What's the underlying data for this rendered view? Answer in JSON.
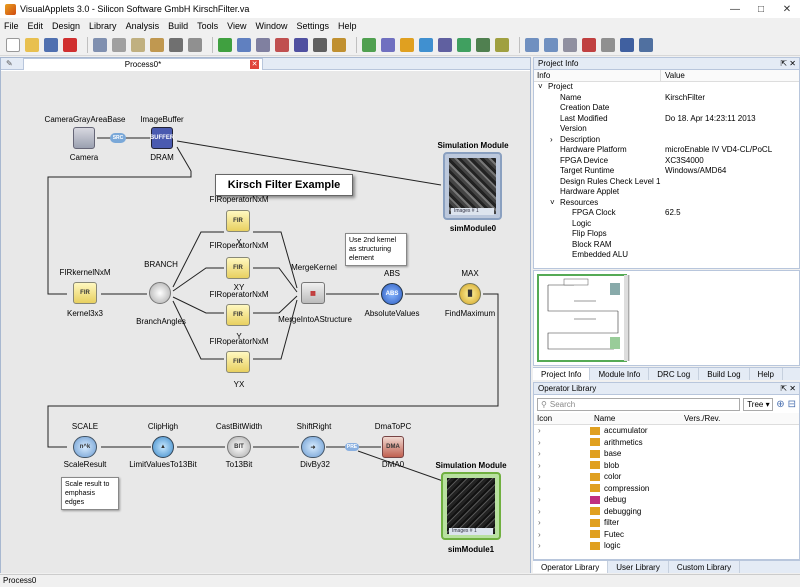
{
  "window": {
    "title": "VisualApplets 3.0 - Silicon Software GmbH   KirschFilter.va"
  },
  "menu": [
    "File",
    "Edit",
    "Design",
    "Library",
    "Analysis",
    "Build",
    "Tools",
    "View",
    "Window",
    "Settings",
    "Help"
  ],
  "editor": {
    "tab_label": "Process0*",
    "banner": "Kirsch Filter Example",
    "nodes": {
      "camera_top": "CameraGrayAreaBase",
      "camera_bottom": "Camera",
      "imagebuffer_top": "ImageBuffer",
      "imagebuffer_bottom": "DRAM",
      "fir_x_top": "FIRoperatorNxM",
      "fir_x_bottom": "X",
      "fir_xy_top": "FIRoperatorNxM",
      "fir_xy_bottom": "XY",
      "fir_y_top": "FIRoperatorNxM",
      "fir_y_bottom": "Y",
      "fir_yx_top": "FIRoperatorNxM",
      "fir_yx_bottom": "YX",
      "kernel_top": "FIRkernelNxM",
      "kernel_bottom": "Kernel3x3",
      "branch_top": "BRANCH",
      "branch_bottom": "BranchAngles",
      "merge_top": "MergeKernel",
      "merge_bottom": "MergeIntoAStructure",
      "abs_top": "ABS",
      "abs_bottom": "AbsoluteValues",
      "max_top": "MAX",
      "max_bottom": "FindMaximum",
      "scale_top": "SCALE",
      "scale_bottom": "ScaleResult",
      "clip_top": "ClipHigh",
      "clip_bottom": "LimitValuesTo13Bit",
      "cast_top": "CastBitWidth",
      "cast_bottom": "To13Bit",
      "shift_top": "ShiftRight",
      "shift_bottom": "DivBy32",
      "dma_top": "DmaToPC",
      "dma_bottom": "DMA0",
      "sim0_top": "Simulation Module",
      "sim0_bottom": "simModule0",
      "sim1_top": "Simulation Module",
      "sim1_bottom": "simModule1",
      "sim_footer": "Images #",
      "sim_count": "1"
    },
    "icon_text": {
      "fir": "FIR",
      "abs": "ABS",
      "bit": "BIT",
      "dma": "DMA",
      "src": "SRC",
      "buffer": "BUFFER",
      "pre": "PRE",
      "nk": "n^k",
      "nm": "n^m"
    },
    "notes": {
      "structuring": "Use 2nd kernel as structuring element",
      "scale": "Scale result to emphasis edges"
    }
  },
  "project_info": {
    "title": "Project Info",
    "col_info": "Info",
    "col_value": "Value",
    "rows": [
      {
        "k": "Project",
        "v": "",
        "lvl": 0,
        "exp": "v"
      },
      {
        "k": "Name",
        "v": "KirschFilter",
        "lvl": 1,
        "exp": ""
      },
      {
        "k": "Creation Date",
        "v": "",
        "lvl": 1,
        "exp": ""
      },
      {
        "k": "Last Modified",
        "v": "Do 18. Apr 14:23:11 2013",
        "lvl": 1,
        "exp": ""
      },
      {
        "k": "Version",
        "v": "",
        "lvl": 1,
        "exp": ""
      },
      {
        "k": "Description",
        "v": "",
        "lvl": 1,
        "exp": ">"
      },
      {
        "k": "Hardware Platform",
        "v": "microEnable IV VD4-CL/PoCL",
        "lvl": 1,
        "exp": ""
      },
      {
        "k": "FPGA Device",
        "v": "XC3S4000",
        "lvl": 1,
        "exp": ""
      },
      {
        "k": "Target Runtime",
        "v": "Windows/AMD64",
        "lvl": 1,
        "exp": ""
      },
      {
        "k": "Design Rules Check Level 1",
        "v": "",
        "lvl": 1,
        "exp": ""
      },
      {
        "k": "Hardware Applet",
        "v": "",
        "lvl": 1,
        "exp": ""
      },
      {
        "k": "Resources",
        "v": "",
        "lvl": 1,
        "exp": "v"
      },
      {
        "k": "FPGA Clock",
        "v": "62.5",
        "lvl": 2,
        "exp": ""
      },
      {
        "k": "Logic",
        "v": "",
        "lvl": 2,
        "exp": ""
      },
      {
        "k": "Flip Flops",
        "v": "",
        "lvl": 2,
        "exp": ""
      },
      {
        "k": "Block RAM",
        "v": "",
        "lvl": 2,
        "exp": ""
      },
      {
        "k": "Embedded ALU",
        "v": "",
        "lvl": 2,
        "exp": ""
      }
    ],
    "tabs": [
      "Project Info",
      "Module Info",
      "DRC Log",
      "Build Log",
      "Help"
    ]
  },
  "operator_library": {
    "title": "Operator Library",
    "search_placeholder": "Search",
    "view_mode": "Tree",
    "col_icon": "Icon",
    "col_name": "Name",
    "col_version": "Vers./Rev.",
    "items": [
      {
        "name": "accumulator",
        "color": "#e0a020"
      },
      {
        "name": "arithmetics",
        "color": "#e0a020"
      },
      {
        "name": "base",
        "color": "#e0a020"
      },
      {
        "name": "blob",
        "color": "#e0a020"
      },
      {
        "name": "color",
        "color": "#e0a020"
      },
      {
        "name": "compression",
        "color": "#e0a020"
      },
      {
        "name": "debug",
        "color": "#c03080"
      },
      {
        "name": "debugging",
        "color": "#e0a020"
      },
      {
        "name": "filter",
        "color": "#e0a020"
      },
      {
        "name": "Futec",
        "color": "#e0a020"
      },
      {
        "name": "logic",
        "color": "#e0a020"
      }
    ],
    "tabs": [
      "Operator Library",
      "User Library",
      "Custom Library"
    ]
  },
  "statusbar": {
    "text": "Process0"
  }
}
